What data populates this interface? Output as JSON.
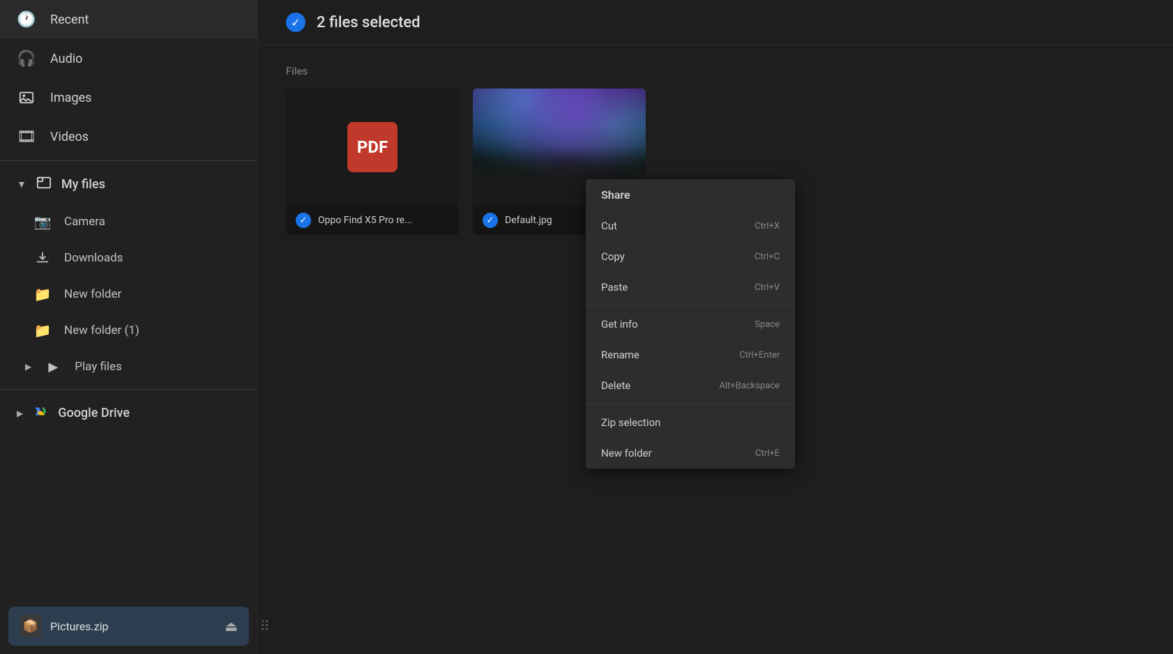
{
  "sidebar": {
    "items": [
      {
        "id": "recent",
        "label": "Recent",
        "icon": "🕐"
      },
      {
        "id": "audio",
        "label": "Audio",
        "icon": "🎧"
      },
      {
        "id": "images",
        "label": "Images",
        "icon": "🖼"
      },
      {
        "id": "videos",
        "label": "Videos",
        "icon": "🎞"
      }
    ],
    "my_files": {
      "label": "My files",
      "icon": "💻",
      "sub_items": [
        {
          "id": "camera",
          "label": "Camera",
          "icon": "📷"
        },
        {
          "id": "downloads",
          "label": "Downloads",
          "icon": "⬇"
        },
        {
          "id": "new_folder",
          "label": "New folder",
          "icon": "📁"
        },
        {
          "id": "new_folder_1",
          "label": "New folder (1)",
          "icon": "📁"
        },
        {
          "id": "play_files",
          "label": "Play files",
          "icon": "▶"
        }
      ]
    },
    "google_drive": {
      "label": "Google Drive",
      "icon": "☁"
    },
    "footer": {
      "filename": "Pictures.zip",
      "file_icon": "📦",
      "eject_label": "⏏"
    }
  },
  "header": {
    "selection_count": "2 files selected",
    "check_icon": "✓"
  },
  "main": {
    "files_label": "Files",
    "files": [
      {
        "id": "pdf-file",
        "name": "Oppo Find X5 Pro re...",
        "type": "pdf",
        "selected": true,
        "check_icon": "✓"
      },
      {
        "id": "image-file",
        "name": "Default.jpg",
        "type": "image",
        "selected": true,
        "check_icon": "✓"
      }
    ]
  },
  "context_menu": {
    "items": [
      {
        "id": "share",
        "label": "Share",
        "shortcut": "",
        "bold": true,
        "divider_after": false
      },
      {
        "id": "cut",
        "label": "Cut",
        "shortcut": "Ctrl+X",
        "bold": false,
        "divider_after": false
      },
      {
        "id": "copy",
        "label": "Copy",
        "shortcut": "Ctrl+C",
        "bold": false,
        "divider_after": false
      },
      {
        "id": "paste",
        "label": "Paste",
        "shortcut": "Ctrl+V",
        "bold": false,
        "divider_after": true
      },
      {
        "id": "get-info",
        "label": "Get info",
        "shortcut": "Space",
        "bold": false,
        "divider_after": false
      },
      {
        "id": "rename",
        "label": "Rename",
        "shortcut": "Ctrl+Enter",
        "bold": false,
        "divider_after": false
      },
      {
        "id": "delete",
        "label": "Delete",
        "shortcut": "Alt+Backspace",
        "bold": false,
        "divider_after": true
      },
      {
        "id": "zip-selection",
        "label": "Zip selection",
        "shortcut": "",
        "bold": false,
        "divider_after": false
      },
      {
        "id": "new-folder",
        "label": "New folder",
        "shortcut": "Ctrl+E",
        "bold": false,
        "divider_after": false
      }
    ]
  }
}
